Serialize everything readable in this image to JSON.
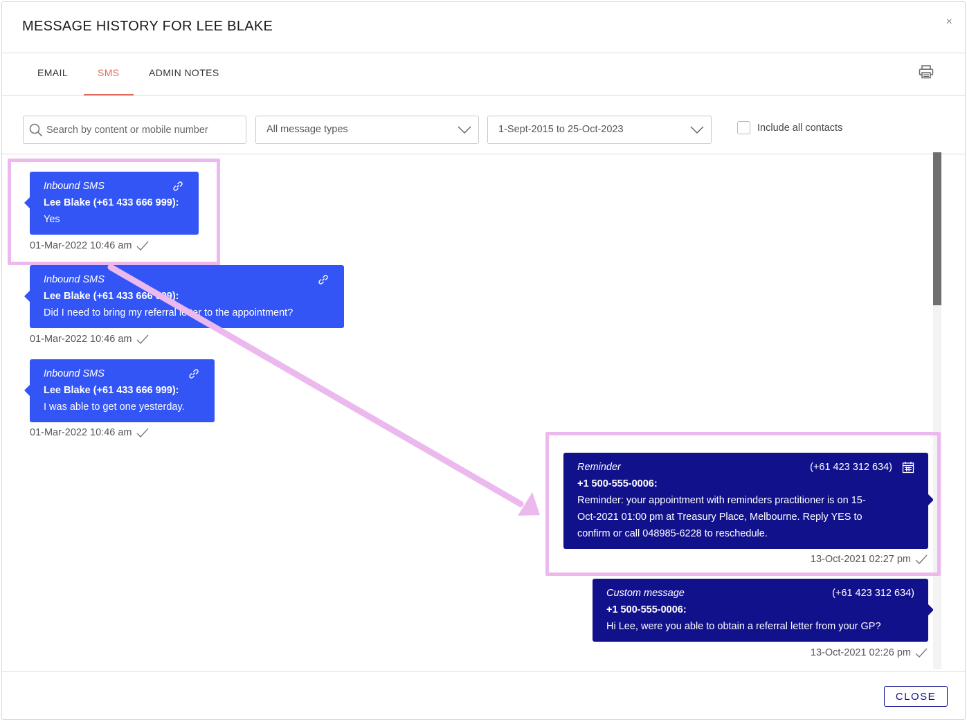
{
  "dialog": {
    "title": "MESSAGE HISTORY FOR LEE BLAKE",
    "close_symbol": "×"
  },
  "tabs": [
    {
      "label": "EMAIL",
      "active": false
    },
    {
      "label": "SMS",
      "active": true
    },
    {
      "label": "ADMIN NOTES",
      "active": false
    }
  ],
  "filters": {
    "search_placeholder": "Search by content or mobile number",
    "message_type": "All message types",
    "date_range": "1-Sept-2015 to 25-Oct-2023",
    "include_all_contacts_label": "Include all contacts",
    "include_all_contacts_checked": false
  },
  "messages": [
    {
      "direction": "inbound",
      "type": "Inbound SMS",
      "sender": "Lee Blake (+61 433 666 999):",
      "lines": [
        "Yes"
      ],
      "timestamp": "01-Mar-2022 10:46 am",
      "icon": "link-icon"
    },
    {
      "direction": "inbound",
      "type": "Inbound SMS",
      "sender": "Lee Blake (+61 433 666 999):",
      "lines": [
        "Did I need to bring my referral letter to the appointment?"
      ],
      "timestamp": "01-Mar-2022 10:46 am",
      "icon": "link-icon"
    },
    {
      "direction": "inbound",
      "type": "Inbound SMS",
      "sender": "Lee Blake (+61 433 666 999):",
      "lines": [
        "I was able to get one yesterday."
      ],
      "timestamp": "01-Mar-2022 10:46 am",
      "icon": "link-icon"
    },
    {
      "direction": "outbound",
      "type": "Reminder",
      "phone": "(+61 423 312 634)",
      "sender": "+1 500-555-0006:",
      "lines": [
        "Reminder: your appointment with reminders practitioner is on 15-",
        "Oct-2021 01:00 pm at Treasury Place, Melbourne. Reply YES to",
        "confirm or call 048985-6228 to reschedule."
      ],
      "timestamp": "13-Oct-2021 02:27 pm",
      "icon": "calendar-icon"
    },
    {
      "direction": "outbound",
      "type": "Custom message",
      "phone": "(+61 423 312 634)",
      "sender": "+1 500-555-0006:",
      "lines": [
        "Hi Lee, were you able to obtain a referral letter from your GP?"
      ],
      "timestamp": "13-Oct-2021 02:26 pm"
    }
  ],
  "footer": {
    "close_label": "CLOSE"
  },
  "colors": {
    "inbound": "#3355f5",
    "outbound": "#12118c",
    "active_tab": "#e06a58",
    "annotation": "#ecb9ee"
  }
}
